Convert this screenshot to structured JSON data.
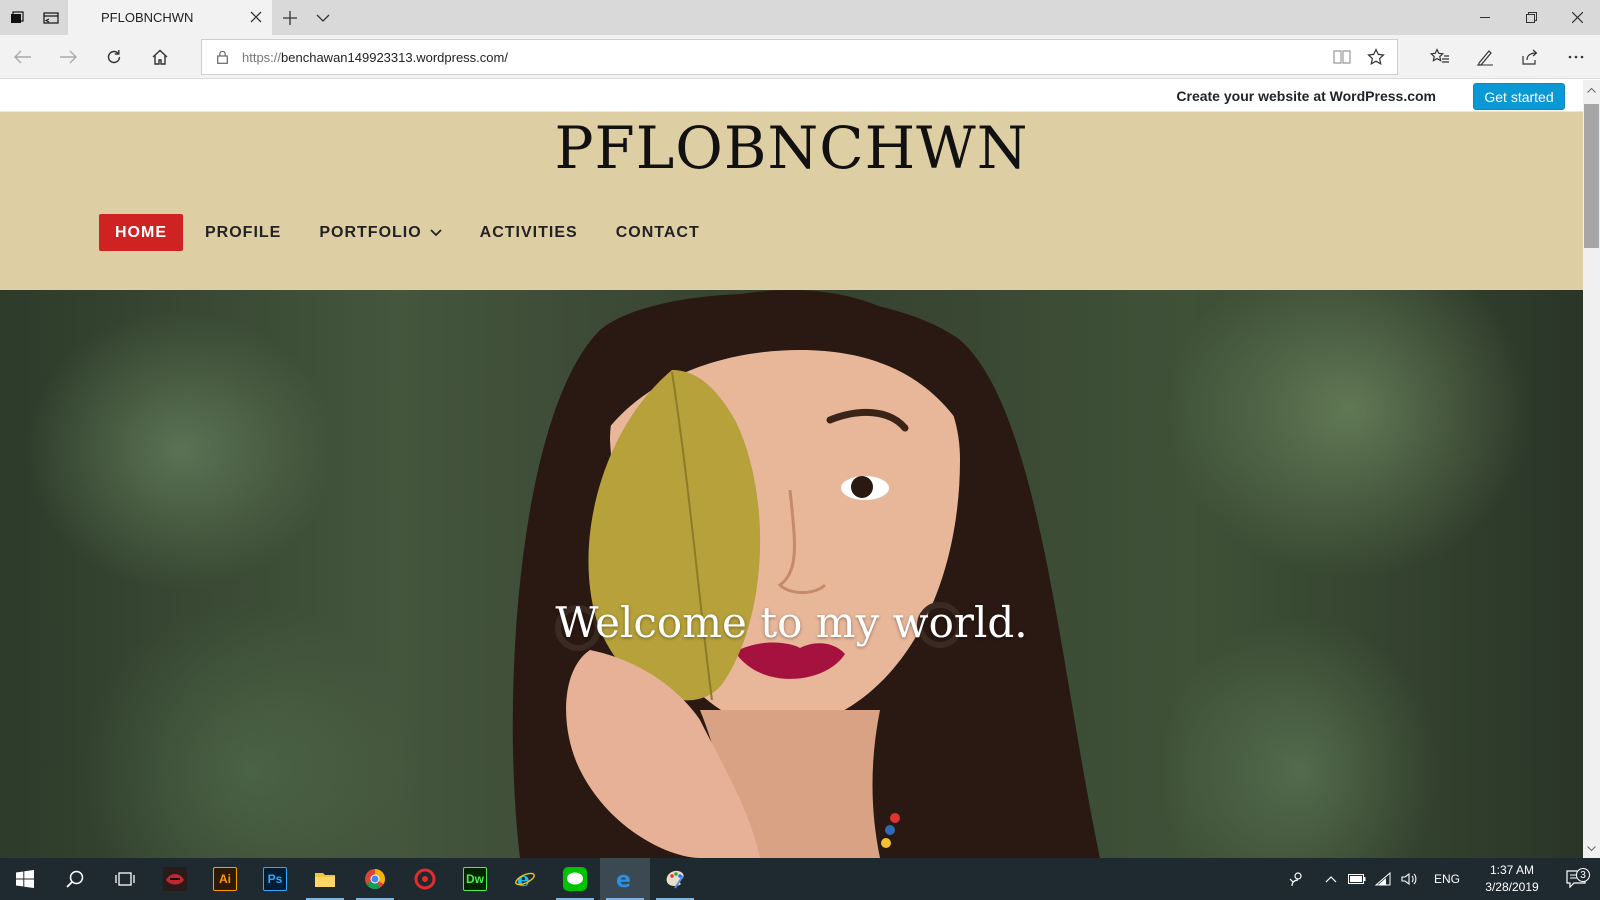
{
  "browser": {
    "tab_title": "PFLOBNCHWN",
    "url_scheme": "https://",
    "url_host": "benchawan149923313.wordpress.com/"
  },
  "wp_banner": {
    "text": "Create your website at WordPress.com",
    "button": "Get started"
  },
  "site": {
    "title": "PFLOBNCHWN",
    "nav": [
      {
        "label": "HOME",
        "active": true
      },
      {
        "label": "PROFILE"
      },
      {
        "label": "PORTFOLIO",
        "has_submenu": true
      },
      {
        "label": "ACTIVITIES"
      },
      {
        "label": "CONTACT"
      }
    ],
    "hero_caption": "Welcome to my world."
  },
  "taskbar": {
    "apps": [
      "Ai",
      "Ps",
      "Dw"
    ],
    "language": "ENG",
    "time": "1:37 AM",
    "date": "3/28/2019",
    "notification_count": "3"
  },
  "colors": {
    "masthead": "#decea4",
    "nav_active": "#cf2323",
    "wp_button": "#0b99d6",
    "taskbar": "#1f2a30"
  }
}
